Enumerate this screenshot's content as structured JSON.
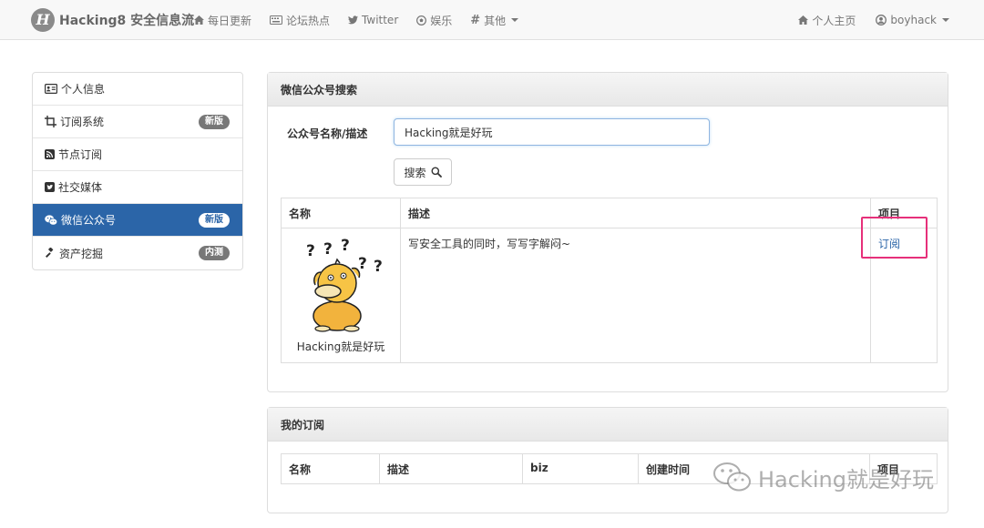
{
  "navbar": {
    "brand": "Hacking8 安全信息流",
    "items": [
      {
        "label": "每日更新",
        "icon": "home-icon"
      },
      {
        "label": "论坛热点",
        "icon": "keyboard-icon"
      },
      {
        "label": "Twitter",
        "icon": "twitter-icon"
      },
      {
        "label": "娱乐",
        "icon": "soccer-ball-icon"
      },
      {
        "label": "其他",
        "icon": "hashtag-icon"
      }
    ],
    "right": [
      {
        "label": "个人主页",
        "icon": "home-icon"
      },
      {
        "label": "boyhack",
        "icon": "user-circle-icon"
      }
    ]
  },
  "sidebar": {
    "items": [
      {
        "label": "个人信息",
        "icon": "id-card-icon",
        "badge": ""
      },
      {
        "label": "订阅系统",
        "icon": "crop-icon",
        "badge": "新版"
      },
      {
        "label": "节点订阅",
        "icon": "rss-icon",
        "badge": ""
      },
      {
        "label": "社交媒体",
        "icon": "twitter-square-icon",
        "badge": ""
      },
      {
        "label": "微信公众号",
        "icon": "wechat-icon",
        "badge": "新版",
        "active": true
      },
      {
        "label": "资产挖掘",
        "icon": "gavel-icon",
        "badge": "内测"
      }
    ]
  },
  "search_panel": {
    "title": "微信公众号搜索",
    "field_label": "公众号名称/描述",
    "input_value": "Hacking就是好玩",
    "button_label": "搜索",
    "table": {
      "headers": [
        "名称",
        "描述",
        "项目"
      ],
      "rows": [
        {
          "name": "Hacking就是好玩",
          "description": "写安全工具的同时，写写字解闷~",
          "action": "订阅"
        }
      ]
    }
  },
  "subscription_panel": {
    "title": "我的订阅",
    "table": {
      "headers": [
        "名称",
        "描述",
        "biz",
        "创建时间",
        "项目"
      ]
    }
  },
  "watermark": "Hacking就是好玩",
  "colors": {
    "accent": "#2b65a8",
    "highlight_box": "#e6307a"
  }
}
